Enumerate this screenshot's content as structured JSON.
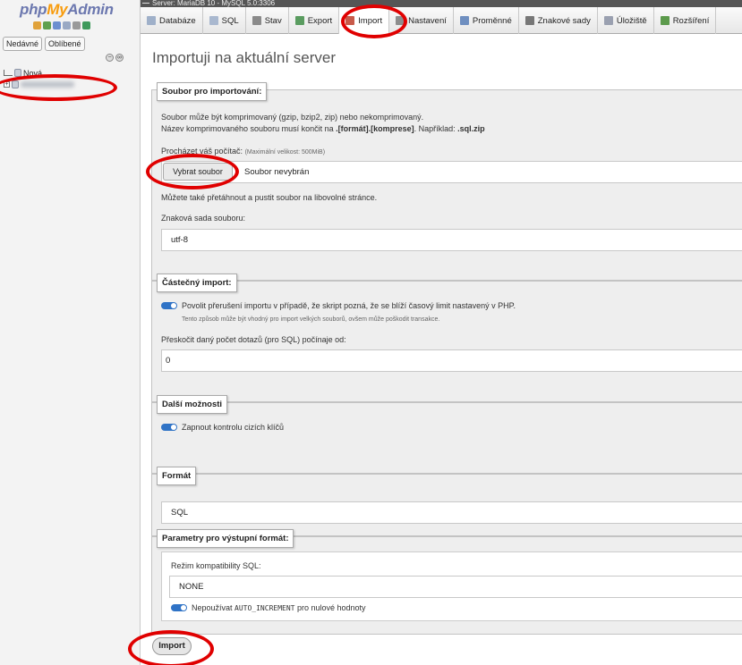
{
  "sidebar": {
    "logo": {
      "php": "php",
      "my": "My",
      "admin": "Admin"
    },
    "recent_label": "Nedávné",
    "favorites_label": "Oblíbené",
    "collapse_all": "−",
    "link_icon": "∞",
    "tree_new_label": "Nová",
    "tree_db_label": ""
  },
  "top": {
    "server_label": "Server: MariaDB 10 - MySQL 5.0:3306",
    "tabs": [
      {
        "label": "Databáze",
        "icon": "database-icon"
      },
      {
        "label": "SQL",
        "icon": "sql-icon"
      },
      {
        "label": "Stav",
        "icon": "status-icon"
      },
      {
        "label": "Export",
        "icon": "export-icon"
      },
      {
        "label": "Import",
        "icon": "import-icon"
      },
      {
        "label": "Nastavení",
        "icon": "wrench-icon"
      },
      {
        "label": "Proměnné",
        "icon": "variables-icon"
      },
      {
        "label": "Znakové sady",
        "icon": "charset-icon"
      },
      {
        "label": "Úložiště",
        "icon": "storage-icon"
      },
      {
        "label": "Rozšíření",
        "icon": "plugin-icon"
      }
    ]
  },
  "main": {
    "title": "Importuji na aktuální server",
    "file_section": {
      "legend": "Soubor pro importování:",
      "info_line1": "Soubor může být komprimovaný (gzip, bzip2, zip) nebo nekomprimovaný.",
      "info_line2_prefix": "Název komprimovaného souboru musí končit na ",
      "info_line2_pattern": ".[formát].[komprese]",
      "info_line2_mid": ". Například: ",
      "info_line2_example": ".sql.zip",
      "browse_label": "Procházet váš počítač:",
      "max_size": "(Maximální velikost: 500MiB)",
      "choose_button": "Vybrat soubor",
      "no_file": "Soubor nevybrán",
      "drag_hint": "Můžete také přetáhnout a pustit soubor na libovolné stránce.",
      "charset_label": "Znaková sada souboru:",
      "charset_value": "utf-8"
    },
    "partial_section": {
      "legend": "Částečný import:",
      "allow_interrupt": "Povolit přerušení importu v případě, že skript pozná, že se blíží časový limit nastavený v PHP.",
      "allow_interrupt_hint": "Tento způsob může být vhodný pro import velkých souborů, ovšem může poškodit transakce.",
      "skip_label": "Přeskočit daný počet dotazů (pro SQL) počínaje od:",
      "skip_value": "0"
    },
    "other_section": {
      "legend": "Další možnosti",
      "fk_checks": "Zapnout kontrolu cizích klíčů"
    },
    "format_section": {
      "legend": "Formát",
      "value": "SQL"
    },
    "params_section": {
      "legend": "Parametry pro výstupní formát:",
      "compat_label": "Režim kompatibility SQL:",
      "compat_value": "NONE",
      "no_ai_prefix": "Nepoužívat ",
      "no_ai_code": "AUTO_INCREMENT",
      "no_ai_suffix": " pro nulové hodnoty"
    },
    "import_button": "Import"
  },
  "colors": {
    "accent_red": "#e00000",
    "toggle_blue": "#2f73c6",
    "logo_blue": "#6c78af",
    "logo_orange": "#f89c0e"
  }
}
